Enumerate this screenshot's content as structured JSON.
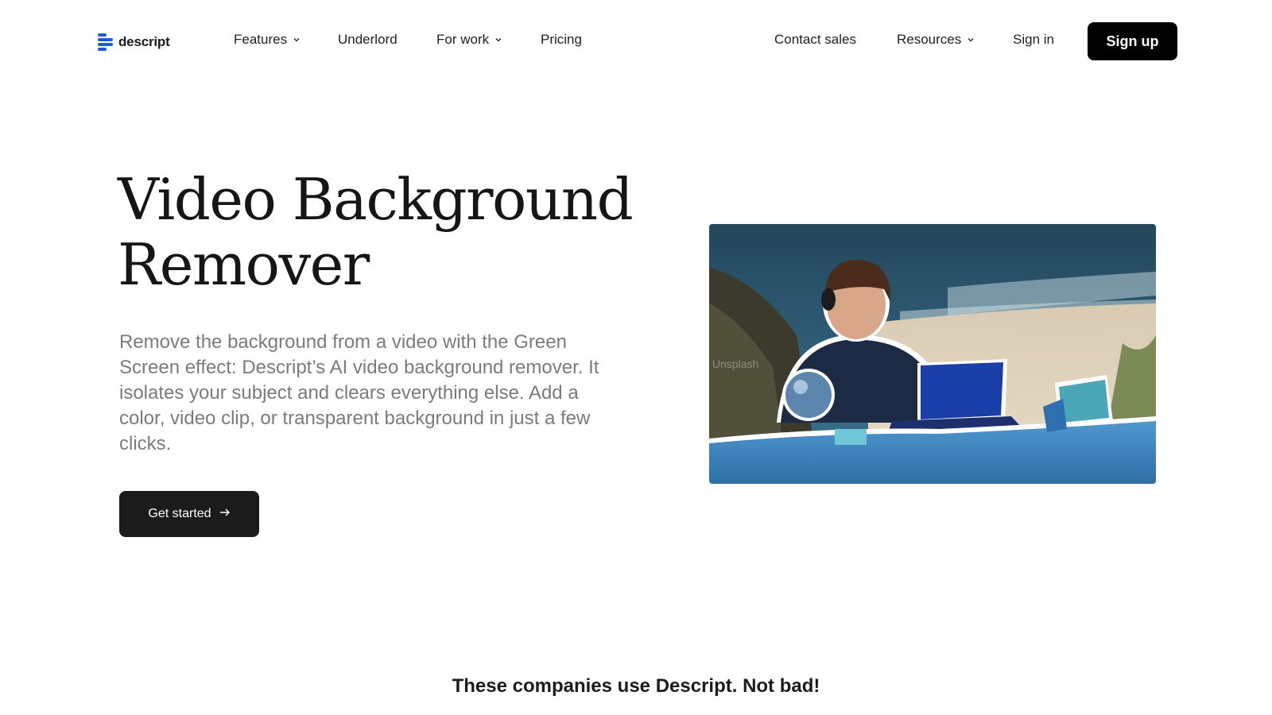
{
  "nav": {
    "logo_text": "descript",
    "logo_color": "#1d5ae0",
    "features": "Features",
    "underlord": "Underlord",
    "for_work": "For work",
    "pricing": "Pricing",
    "contact_sales": "Contact sales",
    "resources": "Resources",
    "sign_in": "Sign in",
    "sign_up": "Sign up"
  },
  "hero": {
    "title_line1": "Video Background",
    "title_line2": "Remover",
    "description": "Remove the background from a video with the Green Screen effect: Descript’s AI video background remover. It isolates your subject and clears everything else. Add a color, video clip, or transparent background in just a few clicks.",
    "cta_label": "Get started",
    "image_watermark": "Unsplash"
  },
  "companies_heading": "These companies use Descript. Not bad!",
  "icons": {
    "logo": "descript-logo-icon",
    "dropdown": "chevron-down-icon",
    "arrow": "arrow-right-icon"
  }
}
